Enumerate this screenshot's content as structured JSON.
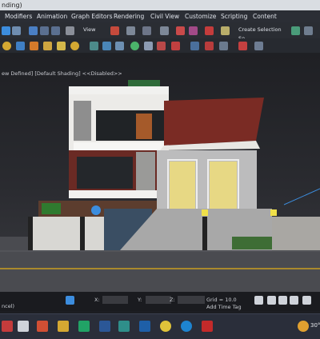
{
  "window": {
    "title": "nding)"
  },
  "menu": {
    "items": [
      "Modifiers",
      "Animation",
      "Graph Editors",
      "Rendering",
      "Civil View",
      "Customize",
      "Scripting",
      "Content"
    ]
  },
  "toolbar": {
    "view_dropdown": "View",
    "selection_set_placeholder": "Create Selection Se"
  },
  "viewport": {
    "label": "ew Defined] [Default Shading] <<Disabled>>"
  },
  "status": {
    "prompt": "ncel)",
    "x_label": "X:",
    "y_label": "Y:",
    "z_label": "Z:",
    "grid": "Grid = 10.0",
    "add_time_tag": "Add Time Tag"
  },
  "taskbar": {
    "temperature": "30°"
  },
  "colors": {
    "accent": "#3c8dde",
    "menu_bg": "#2b2e35",
    "viewport_bg": "#2a2b30"
  }
}
